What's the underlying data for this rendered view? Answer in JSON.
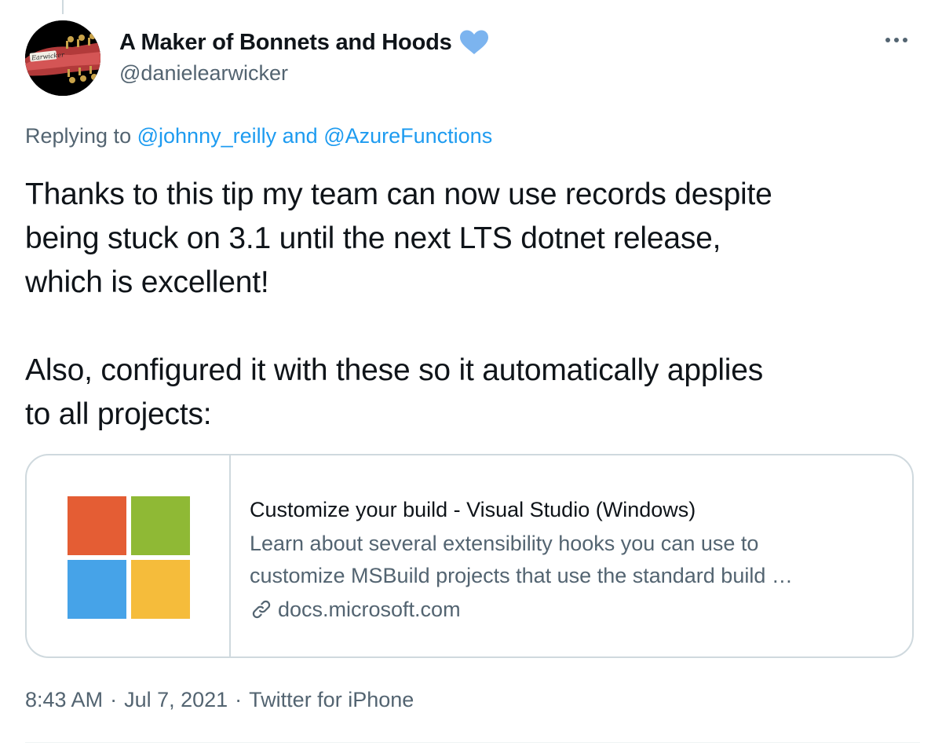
{
  "author": {
    "display_name": "A Maker of Bonnets and Hoods",
    "handle": "@danielearwicker",
    "badge_icon": "blue-heart-icon",
    "avatar_label": "Earwicker"
  },
  "reply": {
    "prefix": "Replying to",
    "mention_1": "@johnny_reilly",
    "conjunction": "and",
    "mention_2": "@AzureFunctions"
  },
  "tweet": {
    "text": "Thanks to this tip my team can now use records despite\nbeing stuck on 3.1 until the next LTS dotnet release,\nwhich is excellent!\n\nAlso, configured it with these so it automatically applies\nto all projects:"
  },
  "card": {
    "title": "Customize your build - Visual Studio (Windows)",
    "description_line_1": "Learn about several extensibility hooks you can use to",
    "description_line_2": "customize MSBuild projects that use the standard build …",
    "domain": "docs.microsoft.com",
    "logo_colors": [
      "#e45d34",
      "#8fb935",
      "#46a3e8",
      "#f5bc3b"
    ]
  },
  "meta": {
    "time": "8:43 AM",
    "separator": "·",
    "date": "Jul 7, 2021",
    "source": "Twitter for iPhone"
  },
  "colors": {
    "accent": "#1d9bf0",
    "secondary_text": "#536471",
    "border": "#cfd9de"
  }
}
